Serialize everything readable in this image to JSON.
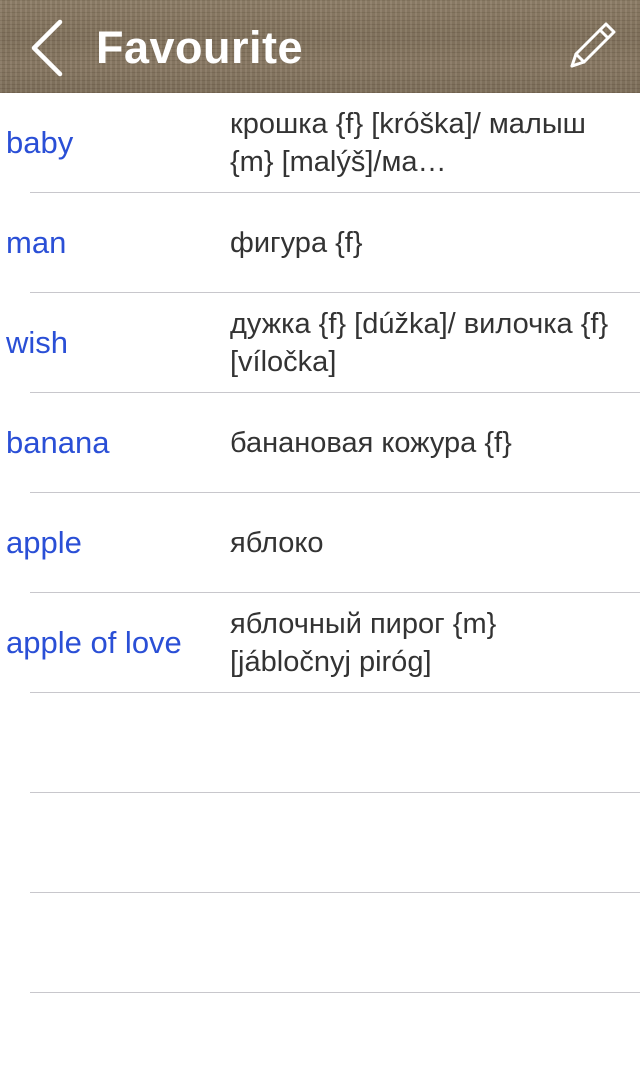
{
  "header": {
    "title": "Favourite",
    "back_icon": "chevron-left-icon",
    "edit_icon": "pencil-icon"
  },
  "entries": [
    {
      "word": "baby",
      "translation": "крошка {f} [króška]/ малыш {m} [malýš]/ма…"
    },
    {
      "word": "man",
      "translation": "фигура {f}"
    },
    {
      "word": "wish",
      "translation": "дужка {f} [dúžka]/ вилочка {f} [víločka]"
    },
    {
      "word": "banana",
      "translation": "банановая кожура {f}"
    },
    {
      "word": "apple",
      "translation": "яблоко"
    },
    {
      "word": "apple of love",
      "translation": "яблочный пирог {m} [jábločnyj piróg]"
    }
  ],
  "colors": {
    "word": "#2a4fd6",
    "translation": "#333333",
    "separator": "#c8c7cc",
    "header_text": "#ffffff"
  }
}
